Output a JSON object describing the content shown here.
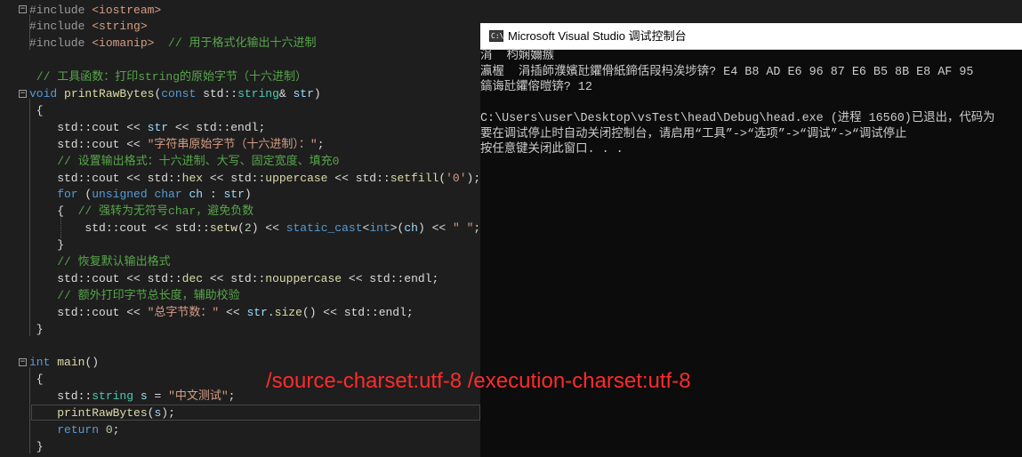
{
  "editor": {
    "lines": [
      {
        "parts": [
          [
            "pp",
            "#include "
          ],
          [
            "inc",
            "<iostream>"
          ]
        ]
      },
      {
        "parts": [
          [
            "pp",
            "#include "
          ],
          [
            "inc",
            "<string>"
          ]
        ]
      },
      {
        "parts": [
          [
            "pp",
            "#include "
          ],
          [
            "inc",
            "<iomanip>"
          ],
          [
            "ns",
            "  "
          ],
          [
            "cmt",
            "// 用于格式化输出十六进制"
          ]
        ]
      },
      {
        "parts": []
      },
      {
        "parts": [
          [
            "cmt",
            " // 工具函数：打印string的原始字节（十六进制）"
          ]
        ]
      },
      {
        "parts": [
          [
            "kw",
            "void "
          ],
          [
            "fn",
            "printRawBytes"
          ],
          [
            "ns",
            "("
          ],
          [
            "kw",
            "const "
          ],
          [
            "ns",
            "std::"
          ],
          [
            "ty",
            "string"
          ],
          [
            "ns",
            "& "
          ],
          [
            "var",
            "str"
          ],
          [
            "ns",
            ")"
          ]
        ]
      },
      {
        "parts": [
          [
            "ns",
            " {"
          ]
        ]
      },
      {
        "parts": [
          [
            "ns",
            "    std::"
          ],
          [
            "ns",
            "cout << "
          ],
          [
            "var",
            "str"
          ],
          [
            "ns",
            " << std::endl;"
          ]
        ]
      },
      {
        "parts": [
          [
            "ns",
            "    std::cout << "
          ],
          [
            "str",
            "\"字符串原始字节（十六进制）：\""
          ],
          [
            "ns",
            ";"
          ]
        ]
      },
      {
        "parts": [
          [
            "cmt",
            "    // 设置输出格式：十六进制、大写、固定宽度、填充0"
          ]
        ]
      },
      {
        "parts": [
          [
            "ns",
            "    std::cout << std::"
          ],
          [
            "fn",
            "hex"
          ],
          [
            "ns",
            " << std::"
          ],
          [
            "fn",
            "uppercase"
          ],
          [
            "ns",
            " << std::"
          ],
          [
            "fn",
            "setfill"
          ],
          [
            "ns",
            "("
          ],
          [
            "str",
            "'0'"
          ],
          [
            "ns",
            ");"
          ]
        ]
      },
      {
        "parts": [
          [
            "kw",
            "    for "
          ],
          [
            "ns",
            "("
          ],
          [
            "kw",
            "unsigned char "
          ],
          [
            "var",
            "ch"
          ],
          [
            "ns",
            " : "
          ],
          [
            "var",
            "str"
          ],
          [
            "ns",
            ")"
          ]
        ]
      },
      {
        "parts": [
          [
            "ns",
            "    {  "
          ],
          [
            "cmt",
            "// 强转为无符号char，避免负数"
          ]
        ]
      },
      {
        "parts": [
          [
            "ns",
            "        std::cout << std::"
          ],
          [
            "fn",
            "setw"
          ],
          [
            "ns",
            "("
          ],
          [
            "num",
            "2"
          ],
          [
            "ns",
            ") << "
          ],
          [
            "kw",
            "static_cast"
          ],
          [
            "ns",
            "<"
          ],
          [
            "kw",
            "int"
          ],
          [
            "ns",
            ">("
          ],
          [
            "var",
            "ch"
          ],
          [
            "ns",
            ") << "
          ],
          [
            "str",
            "\" \""
          ],
          [
            "ns",
            ";"
          ]
        ]
      },
      {
        "parts": [
          [
            "ns",
            "    }"
          ]
        ]
      },
      {
        "parts": [
          [
            "cmt",
            "    // 恢复默认输出格式"
          ]
        ]
      },
      {
        "parts": [
          [
            "ns",
            "    std::cout << std::"
          ],
          [
            "fn",
            "dec"
          ],
          [
            "ns",
            " << std::"
          ],
          [
            "fn",
            "nouppercase"
          ],
          [
            "ns",
            " << std::endl;"
          ]
        ]
      },
      {
        "parts": [
          [
            "cmt",
            "    // 额外打印字节总长度，辅助校验"
          ]
        ]
      },
      {
        "parts": [
          [
            "ns",
            "    std::cout << "
          ],
          [
            "str",
            "\"总字节数：\""
          ],
          [
            "ns",
            " << "
          ],
          [
            "var",
            "str"
          ],
          [
            "ns",
            "."
          ],
          [
            "fn",
            "size"
          ],
          [
            "ns",
            "() << std::endl;"
          ]
        ]
      },
      {
        "parts": [
          [
            "ns",
            " }"
          ]
        ]
      },
      {
        "parts": []
      },
      {
        "parts": [
          [
            "kw",
            "int "
          ],
          [
            "fn",
            "main"
          ],
          [
            "ns",
            "()"
          ]
        ]
      },
      {
        "parts": [
          [
            "ns",
            " {"
          ]
        ]
      },
      {
        "parts": [
          [
            "ns",
            "    std::"
          ],
          [
            "ty",
            "string"
          ],
          [
            "ns",
            " "
          ],
          [
            "var",
            "s"
          ],
          [
            "ns",
            " = "
          ],
          [
            "str",
            "\"中文测试\""
          ],
          [
            "ns",
            ";"
          ]
        ]
      },
      {
        "parts": [
          [
            "ns",
            "    "
          ],
          [
            "fn",
            "printRawBytes"
          ],
          [
            "ns",
            "("
          ],
          [
            "var",
            "s"
          ],
          [
            "ns",
            ");"
          ]
        ]
      },
      {
        "parts": [
          [
            "ns",
            "    "
          ],
          [
            "kw",
            "return "
          ],
          [
            "num",
            "0"
          ],
          [
            "ns",
            ";"
          ]
        ]
      },
      {
        "parts": [
          [
            "ns",
            " }"
          ]
        ]
      }
    ],
    "fold_markers": [
      "−",
      "−",
      "−"
    ]
  },
  "console": {
    "title": "Microsoft Visual Studio 调试控制台",
    "icon_label": "C:\\",
    "output": [
      "涓  枃娴嬭瘯",
      "瀛楃  涓插師濮嬪瓧鑺傦紙鍗佸叚杩涘埗锛? E4 B8 AD E6 96 87 E6 B5 8B E8 AF 95",
      "鎬诲瓧鑺傛暟锛? 12",
      "",
      "C:\\Users\\user\\Desktop\\vsTest\\head\\Debug\\head.exe (进程 16560)已退出，代码为",
      "要在调试停止时自动关闭控制台，请启用“工具”->“选项”->“调试”->“调试停止",
      "按任意键关闭此窗口. . ."
    ]
  },
  "annotation": "/source-charset:utf-8 /execution-charset:utf-8"
}
